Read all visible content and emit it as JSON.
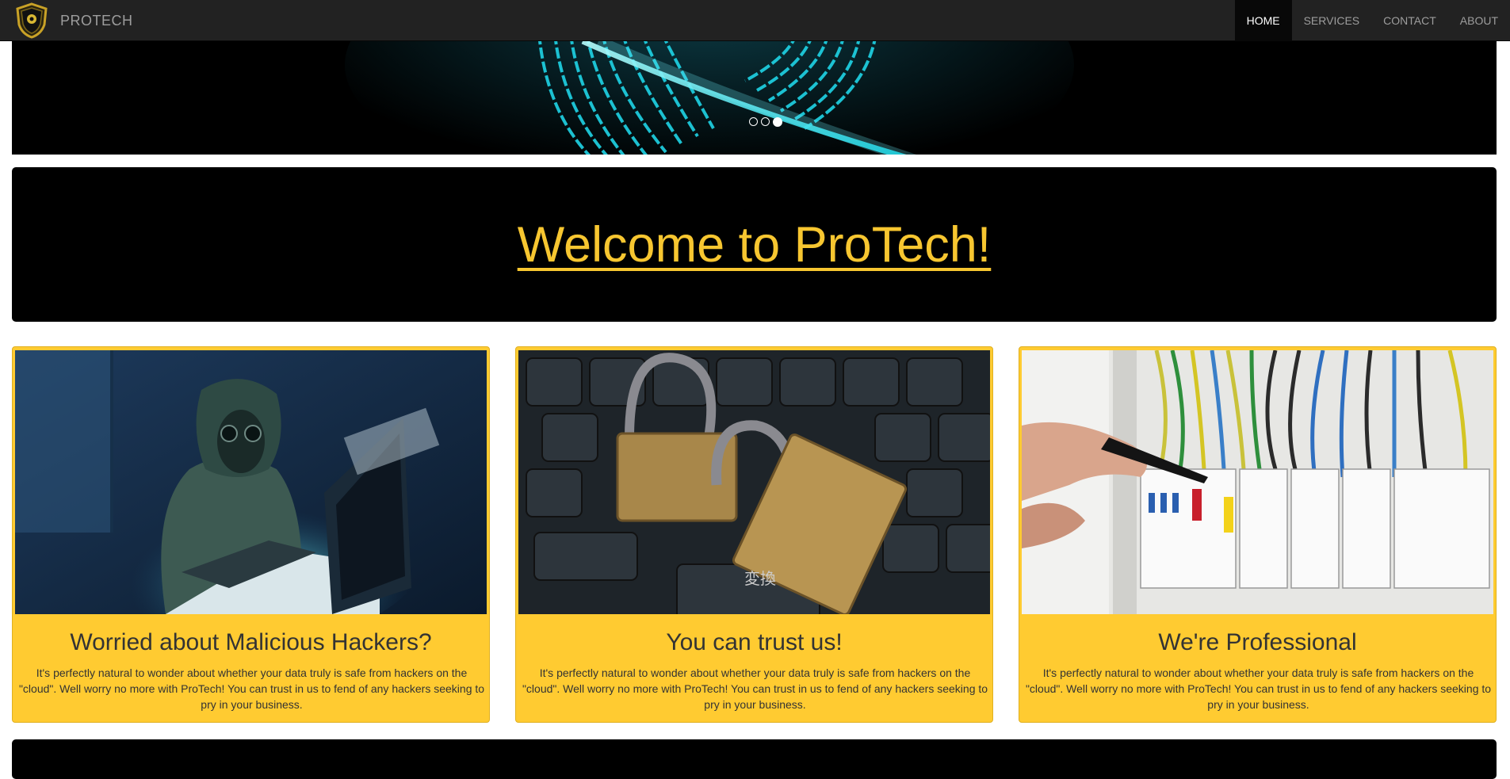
{
  "navbar": {
    "brand": "PROTECH",
    "items": [
      {
        "label": "HOME",
        "active": true
      },
      {
        "label": "SERVICES",
        "active": false
      },
      {
        "label": "CONTACT",
        "active": false
      },
      {
        "label": "ABOUT",
        "active": false
      }
    ]
  },
  "carousel": {
    "slide_count": 3,
    "active_slide": 3
  },
  "jumbotron": {
    "heading": "Welcome to ProTech!"
  },
  "cards": [
    {
      "title": "Worried about Malicious Hackers?",
      "text": "It's perfectly natural to wonder about whether your data truly is safe from hackers on the \"cloud\". Well worry no more with ProTech! You can trust in us to fend of any hackers seeking to pry in your business."
    },
    {
      "title": "You can trust us!",
      "text": "It's perfectly natural to wonder about whether your data truly is safe from hackers on the \"cloud\". Well worry no more with ProTech! You can trust in us to fend of any hackers seeking to pry in your business."
    },
    {
      "title": "We're Professional",
      "text": "It's perfectly natural to wonder about whether your data truly is safe from hackers on the \"cloud\". Well worry no more with ProTech! You can trust in us to fend of any hackers seeking to pry in your business."
    }
  ],
  "colors": {
    "accent": "#ffcb31",
    "heading": "#f7c630",
    "navbar": "#222222"
  }
}
